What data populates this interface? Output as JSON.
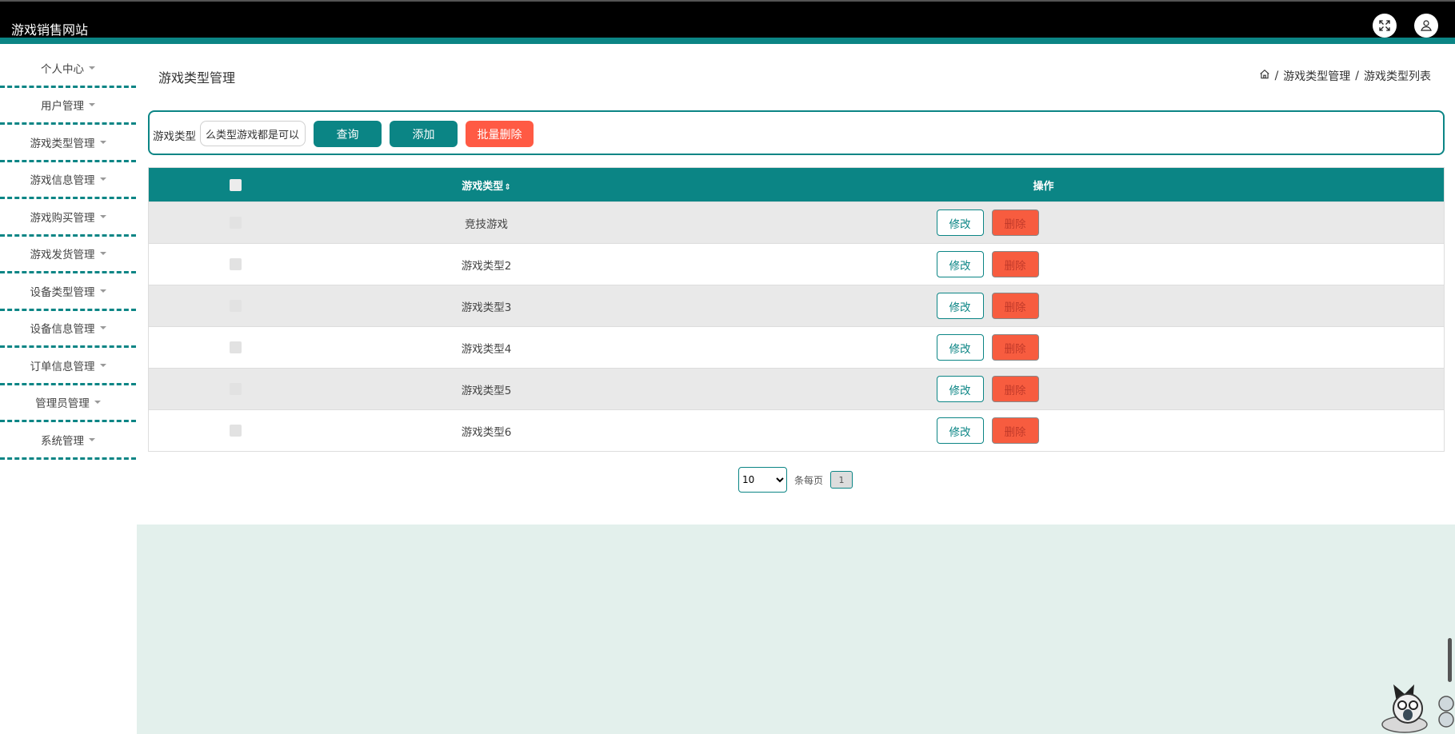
{
  "header": {
    "title": "游戏销售网站",
    "fullscreen_icon": "fullscreen-icon",
    "user_icon": "user-icon"
  },
  "sidebar": {
    "items": [
      {
        "label": "个人中心"
      },
      {
        "label": "用户管理"
      },
      {
        "label": "游戏类型管理"
      },
      {
        "label": "游戏信息管理"
      },
      {
        "label": "游戏购买管理"
      },
      {
        "label": "游戏发货管理"
      },
      {
        "label": "设备类型管理"
      },
      {
        "label": "设备信息管理"
      },
      {
        "label": "订单信息管理"
      },
      {
        "label": "管理员管理"
      },
      {
        "label": "系统管理"
      }
    ]
  },
  "main": {
    "title": "游戏类型管理",
    "breadcrumb": [
      "游戏类型管理",
      "游戏类型列表"
    ],
    "breadcrumb_sep": "/"
  },
  "search": {
    "label": "游戏类型",
    "value": "么类型游戏都是可以自行",
    "query_label": "查询",
    "add_label": "添加",
    "batch_delete_label": "批量删除"
  },
  "table": {
    "headers": {
      "type": "游戏类型",
      "sort_glyph": "⇕",
      "op": "操作"
    },
    "rows": [
      {
        "type": "竞技游戏",
        "edit": "修改",
        "delete": "删除"
      },
      {
        "type": "游戏类型2",
        "edit": "修改",
        "delete": "删除"
      },
      {
        "type": "游戏类型3",
        "edit": "修改",
        "delete": "删除"
      },
      {
        "type": "游戏类型4",
        "edit": "修改",
        "delete": "删除"
      },
      {
        "type": "游戏类型5",
        "edit": "修改",
        "delete": "删除"
      },
      {
        "type": "游戏类型6",
        "edit": "修改",
        "delete": "删除"
      }
    ]
  },
  "pagination": {
    "page_size": "10",
    "per_page_label": "条每页",
    "current_page": "1"
  },
  "colors": {
    "accent": "#0b8585",
    "danger": "#ff5a44",
    "header_bg": "#000000",
    "panel_bg": "#e3f0ec"
  }
}
